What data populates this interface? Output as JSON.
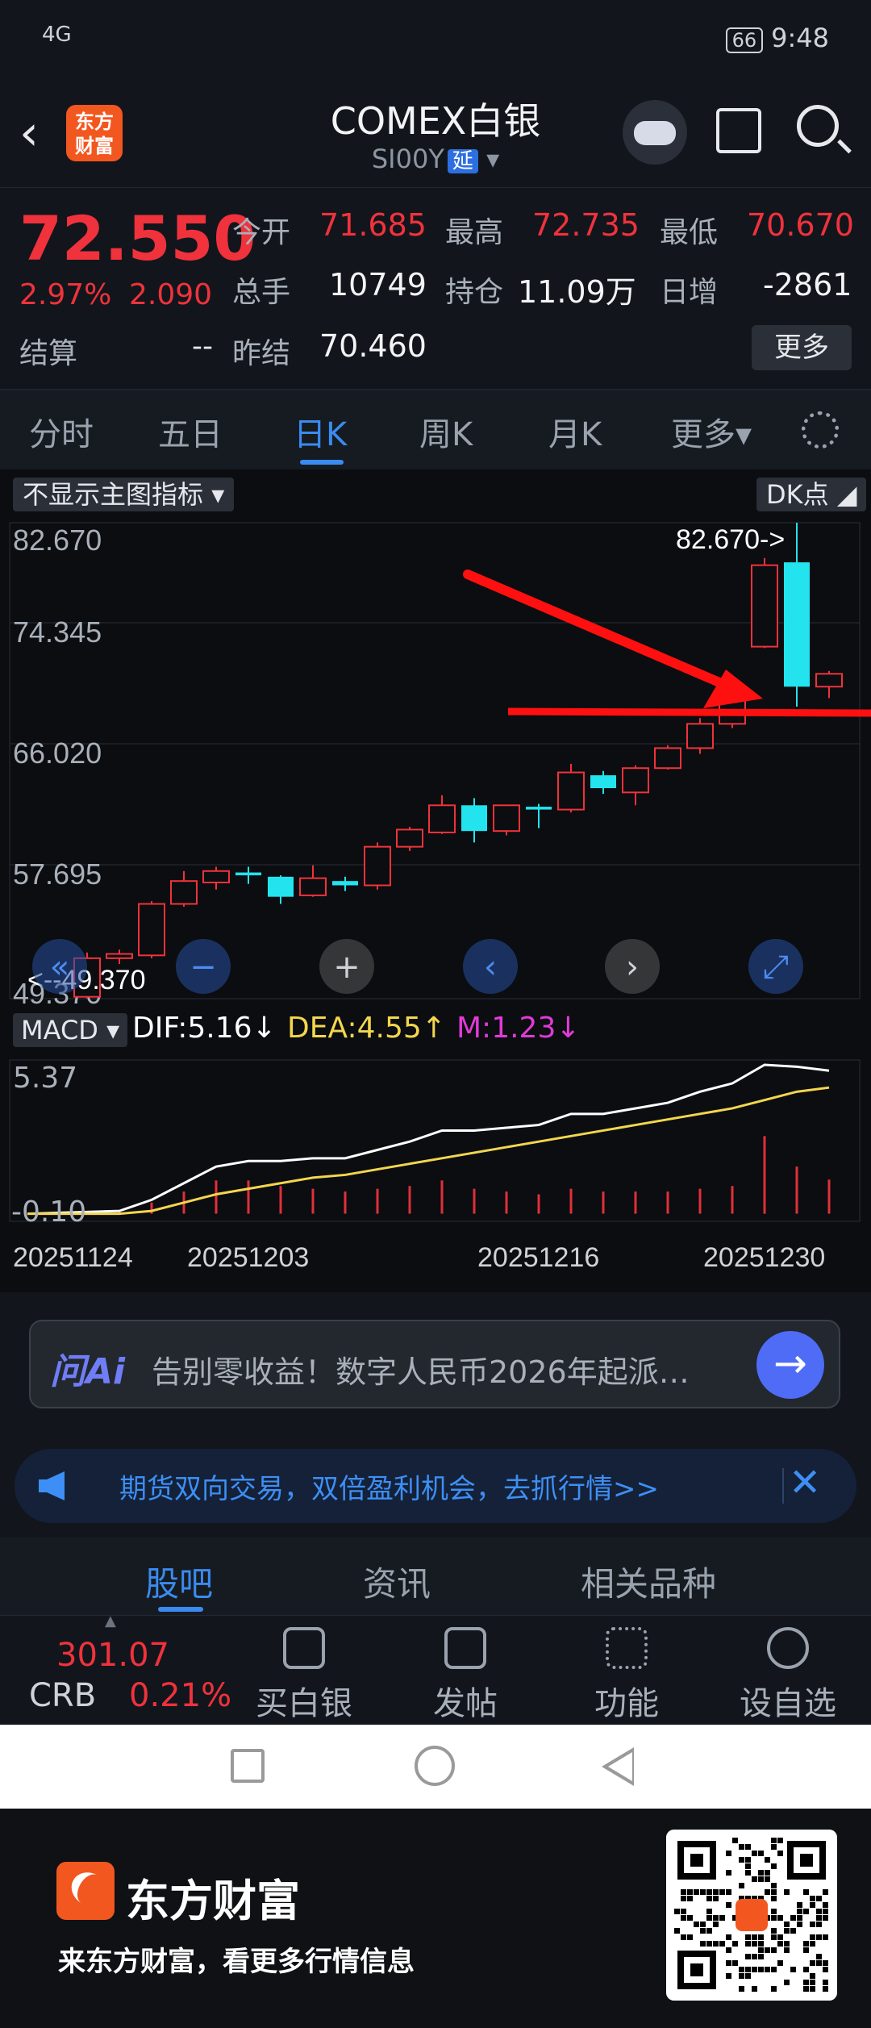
{
  "status": {
    "network": "4G",
    "battery": "66",
    "time": "9:48"
  },
  "header": {
    "title": "COMEX白银",
    "code": "SI00Y",
    "delay_tag": "延",
    "logo_text": "东方财富"
  },
  "quote": {
    "price": "72.550",
    "change_pct": "2.97%",
    "change": "2.090",
    "settle_label": "结算",
    "settle_value": "--",
    "open_label": "今开",
    "open_value": "71.685",
    "high_label": "最高",
    "high_value": "72.735",
    "low_label": "最低",
    "low_value": "70.670",
    "volume_label": "总手",
    "volume_value": "10749",
    "oi_label": "持仓",
    "oi_value": "11.09万",
    "daily_inc_label": "日增",
    "daily_inc_value": "-2861",
    "prev_settle_label": "昨结",
    "prev_settle_value": "70.460",
    "more_label": "更多"
  },
  "tabs": [
    "分时",
    "五日",
    "日K",
    "周K",
    "月K",
    "更多"
  ],
  "indicator_toggle": "不显示主图指标",
  "dk_label": "DK点",
  "macd": {
    "label": "MACD",
    "dif": "DIF:5.16",
    "dea": "DEA:4.55",
    "m": "M:1.23",
    "y_top": "5.37",
    "y_bottom": "-0.10"
  },
  "chart_data": {
    "type": "candlestick",
    "y_ticks": [
      "82.670",
      "74.345",
      "66.020",
      "57.695",
      "49.370"
    ],
    "ylim": [
      49.37,
      82.67
    ],
    "max_label": "82.670->",
    "min_label": "<--49.370",
    "x_ticks": [
      "20251124",
      "20251203",
      "20251216",
      "20251230"
    ],
    "candles": [
      {
        "o": 49.5,
        "c": 52.2,
        "h": 52.6,
        "l": 49.37
      },
      {
        "o": 52.2,
        "c": 52.5,
        "h": 52.8,
        "l": 51.8
      },
      {
        "o": 52.4,
        "c": 56.0,
        "h": 56.2,
        "l": 52.2
      },
      {
        "o": 56.0,
        "c": 57.6,
        "h": 58.3,
        "l": 55.8
      },
      {
        "o": 57.5,
        "c": 58.3,
        "h": 58.6,
        "l": 57.0
      },
      {
        "o": 58.2,
        "c": 58.0,
        "h": 58.6,
        "l": 57.4
      },
      {
        "o": 57.9,
        "c": 56.5,
        "h": 58.0,
        "l": 56.0
      },
      {
        "o": 56.6,
        "c": 57.8,
        "h": 58.7,
        "l": 56.5
      },
      {
        "o": 57.6,
        "c": 57.3,
        "h": 57.9,
        "l": 56.9
      },
      {
        "o": 57.3,
        "c": 60.0,
        "h": 60.3,
        "l": 57.0
      },
      {
        "o": 60.0,
        "c": 61.2,
        "h": 61.4,
        "l": 59.7
      },
      {
        "o": 61.0,
        "c": 62.9,
        "h": 63.6,
        "l": 60.9
      },
      {
        "o": 62.9,
        "c": 61.1,
        "h": 63.4,
        "l": 60.3
      },
      {
        "o": 61.1,
        "c": 62.9,
        "h": 62.9,
        "l": 60.8
      },
      {
        "o": 62.8,
        "c": 62.6,
        "h": 63.0,
        "l": 61.3
      },
      {
        "o": 62.6,
        "c": 65.2,
        "h": 65.8,
        "l": 62.4
      },
      {
        "o": 65.0,
        "c": 64.1,
        "h": 65.3,
        "l": 63.7
      },
      {
        "o": 63.8,
        "c": 65.5,
        "h": 65.7,
        "l": 62.9
      },
      {
        "o": 65.5,
        "c": 66.9,
        "h": 67.1,
        "l": 65.4
      },
      {
        "o": 66.9,
        "c": 68.6,
        "h": 69.0,
        "l": 66.5
      },
      {
        "o": 68.6,
        "c": 70.5,
        "h": 70.6,
        "l": 68.3
      },
      {
        "o": 74.0,
        "c": 79.7,
        "h": 80.2,
        "l": 73.9
      },
      {
        "o": 79.9,
        "c": 71.2,
        "h": 82.67,
        "l": 69.8
      },
      {
        "o": 71.2,
        "c": 72.1,
        "h": 72.3,
        "l": 70.4
      }
    ],
    "macd_dif": [
      0.0,
      0.1,
      0.5,
      1.1,
      1.7,
      1.9,
      1.9,
      2.0,
      2.0,
      2.3,
      2.6,
      3.0,
      3.0,
      3.1,
      3.2,
      3.6,
      3.6,
      3.8,
      4.0,
      4.4,
      4.7,
      5.37,
      5.3,
      5.16
    ],
    "macd_dea": [
      0.0,
      0.0,
      0.1,
      0.4,
      0.7,
      0.9,
      1.1,
      1.3,
      1.4,
      1.6,
      1.8,
      2.0,
      2.2,
      2.4,
      2.6,
      2.8,
      3.0,
      3.2,
      3.4,
      3.6,
      3.8,
      4.1,
      4.4,
      4.55
    ],
    "macd_hist": [
      0.0,
      0.1,
      0.4,
      0.8,
      1.2,
      1.2,
      1.0,
      0.9,
      0.8,
      0.9,
      1.0,
      1.2,
      0.9,
      0.8,
      0.7,
      0.9,
      0.8,
      0.8,
      0.8,
      0.9,
      1.0,
      2.8,
      1.7,
      1.23
    ]
  },
  "ai_bar": {
    "logo": "问Ai",
    "text": "告别零收益！数字人民币2026年起派…"
  },
  "promo": {
    "text": "期货双向交易，双倍盈利机会，去抓行情>>"
  },
  "bottom_tabs": [
    "股吧",
    "资讯",
    "相关品种"
  ],
  "toolbar": {
    "crb_value": "301.07",
    "crb_label": "CRB",
    "crb_pct": "0.21%",
    "items": [
      "买白银",
      "发帖",
      "功能",
      "设自选"
    ]
  },
  "footer": {
    "brand": "东方财富",
    "slogan": "来东方财富，看更多行情信息"
  }
}
